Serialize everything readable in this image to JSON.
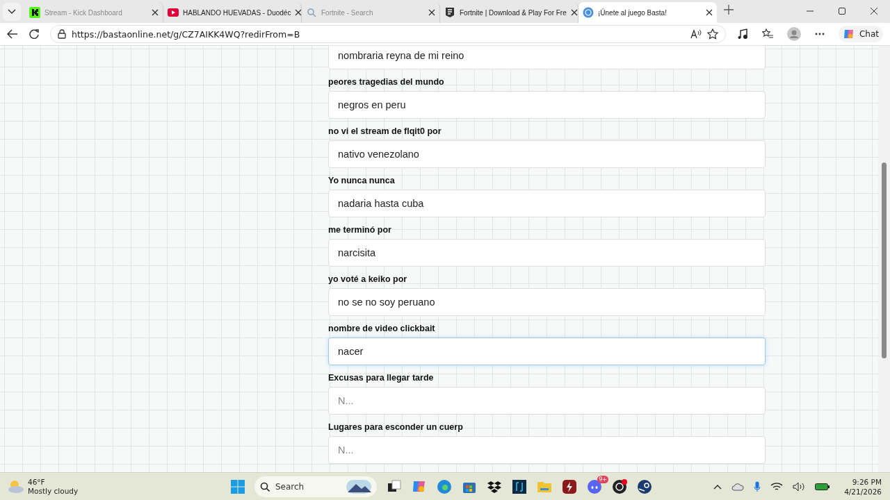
{
  "browser": {
    "tabs": [
      {
        "title": "Stream - Kick Dashboard",
        "selected": false,
        "dim": true
      },
      {
        "title": "HABLANDO HUEVADAS - Duodéc",
        "selected": false,
        "dim": false
      },
      {
        "title": "Fortnite - Search",
        "selected": false,
        "dim": true
      },
      {
        "title": "Fortnite | Download & Play For Fre",
        "selected": false,
        "dim": false
      },
      {
        "title": "¡Únete al juego Basta!",
        "selected": true,
        "dim": false
      }
    ],
    "url": "https://bastaonline.net/g/CZ7AIKK4WQ?redirFrom=B",
    "chat_label": "Chat"
  },
  "form": {
    "fields": [
      {
        "value": "nombraria reyna de mi reino",
        "focused": false
      },
      {
        "label": "peores tragedias del mundo",
        "value": "negros en peru",
        "focused": false
      },
      {
        "label": "no vi el stream de flqit0 por",
        "value": "nativo venezolano",
        "focused": false
      },
      {
        "label": "Yo nunca nunca",
        "value": "nadaria hasta cuba",
        "focused": false
      },
      {
        "label": "me terminó por",
        "value": "narcisita",
        "focused": false
      },
      {
        "label": "yo voté a keiko por",
        "value": "no se no soy peruano",
        "focused": false
      },
      {
        "label": "nombre de video clickbait",
        "value": "nacer",
        "focused": true
      },
      {
        "label": "Excusas para llegar tarde",
        "placeholder": "N...",
        "focused": false
      },
      {
        "label": "Lugares para esconder un cuerp",
        "placeholder": "N...",
        "focused": false
      }
    ]
  },
  "taskbar": {
    "weather": {
      "temp": "46°F",
      "condition": "Mostly cloudy"
    },
    "search_label": "Search",
    "discord_badge": "9+",
    "time": "9:26 PM",
    "date": "4/21/2026"
  }
}
